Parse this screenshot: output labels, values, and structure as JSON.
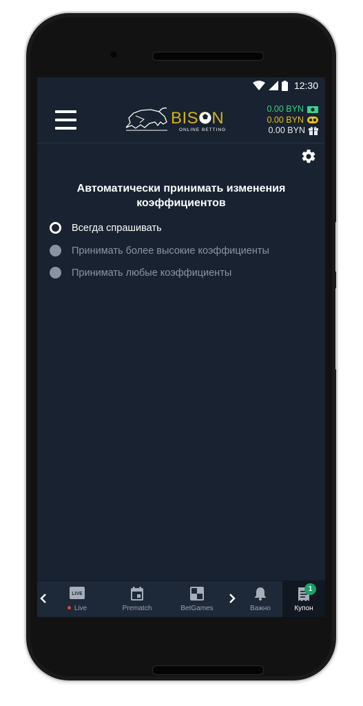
{
  "status_bar": {
    "time": "12:30"
  },
  "header": {
    "logo_text": "BISON",
    "logo_subtitle": "ONLINE BETTING",
    "balances": [
      {
        "value": "0.00 BYN",
        "color": "#3ecf8e",
        "icon": "cash-icon"
      },
      {
        "value": "0.00 BYN",
        "color": "#e7c21d",
        "icon": "bonus-icon"
      },
      {
        "value": "0.00 BYN",
        "color": "#e8ecf1",
        "icon": "gift-icon"
      }
    ]
  },
  "settings": {
    "title": "Автоматически принимать изменения коэффициентов",
    "options": [
      {
        "label": "Всегда спрашивать",
        "selected": true
      },
      {
        "label": "Принимать более высокие коэффициенты",
        "selected": false
      },
      {
        "label": "Принимать любые коэффициенты",
        "selected": false
      }
    ]
  },
  "bottom_nav": {
    "items": [
      {
        "label": "Live",
        "icon": "live-icon",
        "icon_text": "LIVE"
      },
      {
        "label": "Prematch",
        "icon": "calendar-icon"
      },
      {
        "label": "BetGames",
        "icon": "betgames-icon"
      },
      {
        "label": "Важно",
        "icon": "bell-icon"
      },
      {
        "label": "Купон",
        "icon": "coupon-icon",
        "badge": "1",
        "active": true
      }
    ]
  },
  "colors": {
    "screen_bg": "#182230",
    "nav_bg": "#1d2838",
    "accent_green": "#18a36a",
    "logo_gold": "#d4b21c"
  }
}
